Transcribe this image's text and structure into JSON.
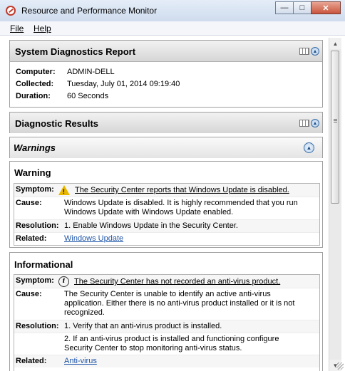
{
  "window": {
    "title": "Resource and Performance Monitor",
    "minimize": "—",
    "maximize": "□",
    "close": "✕"
  },
  "menu": {
    "file": "File",
    "help": "Help"
  },
  "report": {
    "title": "System Diagnostics Report",
    "fields": [
      {
        "label": "Computer:",
        "value": "ADMIN-DELL"
      },
      {
        "label": "Collected:",
        "value": "Tuesday, July 01, 2014 09:19:40"
      },
      {
        "label": "Duration:",
        "value": "60 Seconds"
      }
    ]
  },
  "diagnostic": {
    "title": "Diagnostic Results"
  },
  "warnings": {
    "title": "Warnings",
    "warning": {
      "title": "Warning",
      "symptom_label": "Symptom:",
      "symptom": "The Security Center reports that Windows Update is disabled.",
      "cause_label": "Cause:",
      "cause_line1": "Windows Update is disabled. It is highly recommended that you run",
      "cause_line2": "Windows Update with Windows Update enabled.",
      "resolution_label": "Resolution:",
      "resolution": "1. Enable Windows Update in the Security Center.",
      "related_label": "Related:",
      "related": "Windows Update"
    },
    "informational": {
      "title": "Informational",
      "symptom_label": "Symptom:",
      "symptom": "The Security Center has not recorded an anti-virus product.",
      "cause_label": "Cause:",
      "cause_line1": "The Security Center is unable to identify an active anti-virus",
      "cause_line2": "application. Either there is no anti-virus product installed or it is not",
      "cause_line3": "recognized.",
      "resolution_label": "Resolution:",
      "resolution1": "1. Verify that an anti-virus product is installed.",
      "resolution2_line1": "2. If an anti-virus product is installed and functioning configure",
      "resolution2_line2": "Security Center to stop monitoring anti-virus status.",
      "related_label": "Related:",
      "related": "Anti-virus"
    }
  },
  "icons": {
    "collapse": "▲"
  }
}
